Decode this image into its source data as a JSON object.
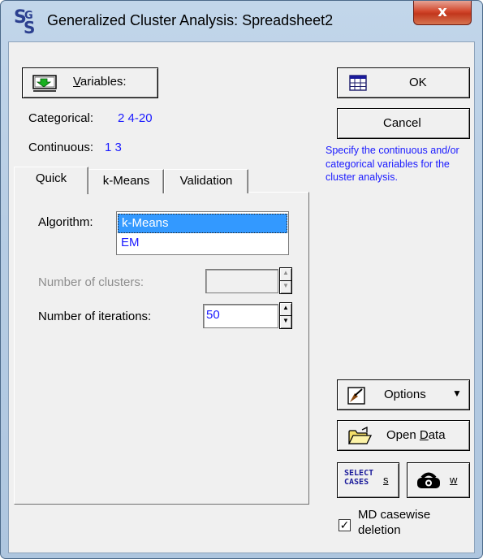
{
  "window": {
    "title": "Generalized Cluster Analysis: Spreadsheet2",
    "close_glyph": "x"
  },
  "variables": {
    "button_label": "Variables:",
    "categorical_label": "Categorical:",
    "categorical_value": "2 4-20",
    "continuous_label": "Continuous:",
    "continuous_value": "1 3"
  },
  "tabs": [
    {
      "label": "Quick",
      "active": true
    },
    {
      "label": "k-Means",
      "active": false
    },
    {
      "label": "Validation",
      "active": false
    }
  ],
  "quick": {
    "algorithm_label": "Algorithm:",
    "algorithm_options": [
      "k-Means",
      "EM"
    ],
    "algorithm_selected": "k-Means",
    "num_clusters_label": "Number of clusters:",
    "num_clusters_value": "",
    "num_iterations_label": "Number of iterations:",
    "num_iterations_value": "50"
  },
  "buttons": {
    "ok": "OK",
    "cancel": "Cancel",
    "options": "Options",
    "open_data": "Open Data",
    "select_cases_icon_text": "SELECT CASES",
    "select_cases_key": "S",
    "weight_key": "W"
  },
  "hint": "Specify the continuous and/or categorical variables for the cluster analysis.",
  "md_casewise": {
    "label_line1": "MD casewise",
    "label_line2": "deletion",
    "checked": true
  },
  "colors": {
    "value_blue": "#1a1aff",
    "selection": "#3399ff",
    "disabled_text": "#8d8d8d"
  }
}
